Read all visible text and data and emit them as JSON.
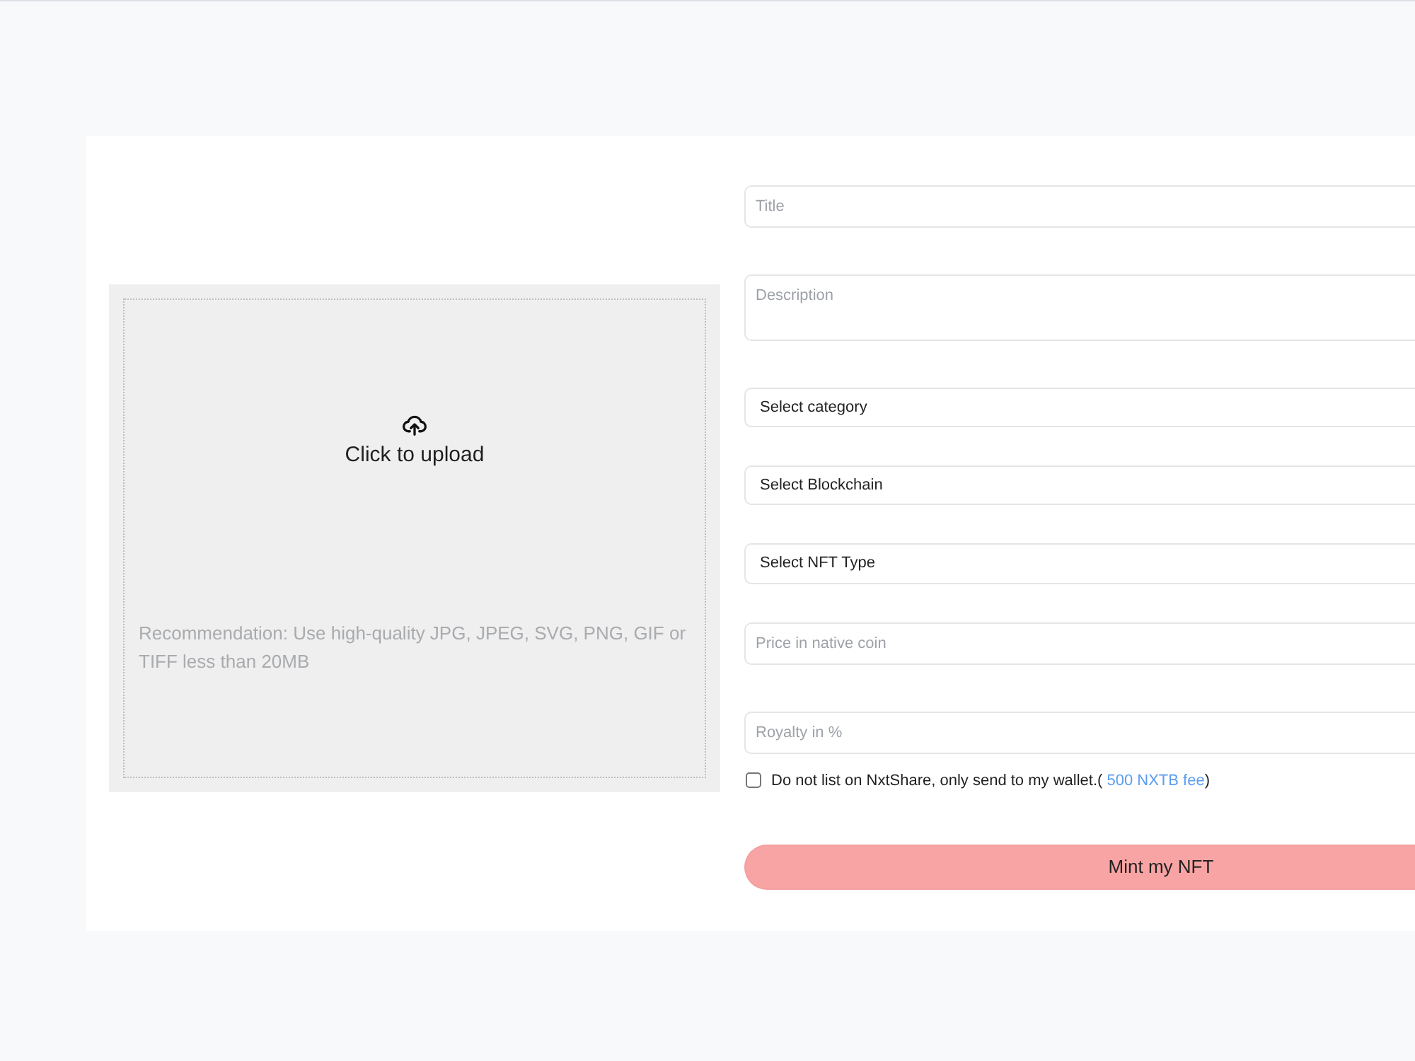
{
  "upload": {
    "label": "Click to upload",
    "recommendation": "Recommendation: Use high-quality JPG, JPEG, SVG, PNG, GIF or TIFF less than 20MB"
  },
  "form": {
    "fields": [
      {
        "kind": "input",
        "placeholder": "Title"
      },
      {
        "kind": "textarea",
        "placeholder": "Description"
      },
      {
        "kind": "select",
        "value": "Select category"
      },
      {
        "kind": "select",
        "value": "Select Blockchain"
      },
      {
        "kind": "select",
        "value": "Select NFT Type"
      },
      {
        "kind": "input",
        "placeholder": "Price in native coin"
      },
      {
        "kind": "input",
        "placeholder": "Royalty in %"
      }
    ],
    "listing_option": {
      "checked": false,
      "label": "Do not list on NxtShare, only send to my wallet.(",
      "link": "500 NXTB fee",
      "label_end": ")"
    },
    "submit_button": "Mint my NFT"
  }
}
